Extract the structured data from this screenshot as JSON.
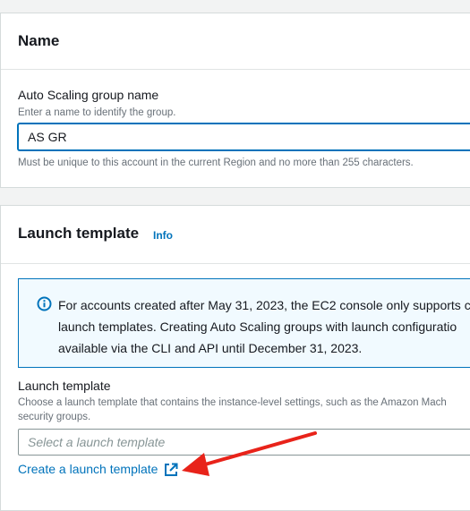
{
  "name_section": {
    "title": "Name",
    "field_label": "Auto Scaling group name",
    "field_hint": "Enter a name to identify the group.",
    "field_value": "AS GR",
    "constraint": "Must be unique to this account in the current Region and no more than 255 characters."
  },
  "launch_section": {
    "title": "Launch template",
    "info_label": "Info",
    "alert_lines": [
      "For accounts created after May 31, 2023, the EC2 console only supports c",
      "launch templates. Creating Auto Scaling groups with launch configuratio",
      "available via the CLI and API until December 31, 2023."
    ],
    "field_label": "Launch template",
    "field_desc_lines": [
      "Choose a launch template that contains the instance-level settings, such as the Amazon Mach",
      "security groups."
    ],
    "select_placeholder": "Select a launch template",
    "create_link": "Create a launch template"
  },
  "colors": {
    "accent": "#0073bb",
    "annotation_arrow": "#e8231a"
  },
  "icons": {
    "info": "info-circle-icon",
    "external": "external-link-icon",
    "annotation": "red-arrow-annotation"
  }
}
